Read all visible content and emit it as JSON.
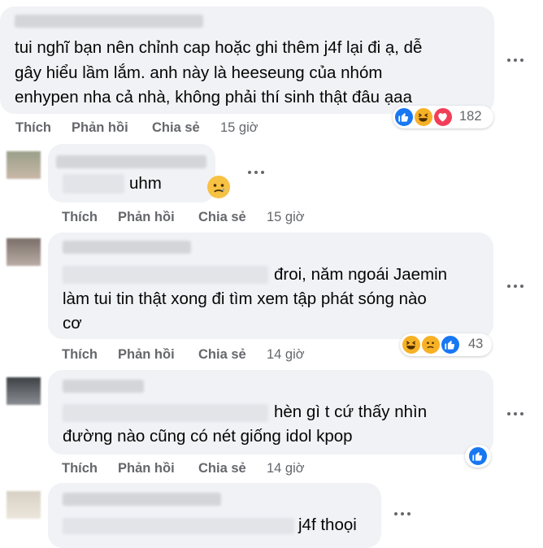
{
  "comments": [
    {
      "lines": [
        "tui nghĩ bạn nên chỉnh cap hoặc ghi thêm j4f lại đi ạ, dễ",
        "gây hiểu lầm lắm. anh này là heeseung của nhóm",
        "enhypen nha cả nhà, không phải thí sinh thật đâu ạaa"
      ],
      "reaction_count": "182",
      "reactions": [
        "like-icon",
        "haha-icon",
        "love-icon"
      ],
      "time": "15 giờ"
    },
    {
      "text": "uhm",
      "reaction_emoji": "sad-face-icon",
      "time": "15 giờ"
    },
    {
      "lines": [
        "đroi, năm ngoái Jaemin",
        "làm tui tin thật xong đi tìm xem tập phát sóng nào",
        "cơ"
      ],
      "reaction_count": "43",
      "reactions": [
        "haha-icon",
        "sad-icon",
        "like-icon"
      ],
      "time": "14 giờ"
    },
    {
      "lines": [
        "hèn gì t cứ thấy nhìn",
        "đường nào cũng có nét giống idol kpop"
      ],
      "reactions": [
        "like-icon"
      ],
      "time": "14 giờ"
    },
    {
      "text": "j4f thoọi"
    }
  ],
  "actions": {
    "like": "Thích",
    "reply": "Phản hồi",
    "share": "Chia sẻ"
  },
  "colors": {
    "bubble": "#f0f2f5",
    "meta": "#65676b",
    "like": "#1877f2",
    "love": "#f33e58",
    "haha": "#f7b125"
  }
}
